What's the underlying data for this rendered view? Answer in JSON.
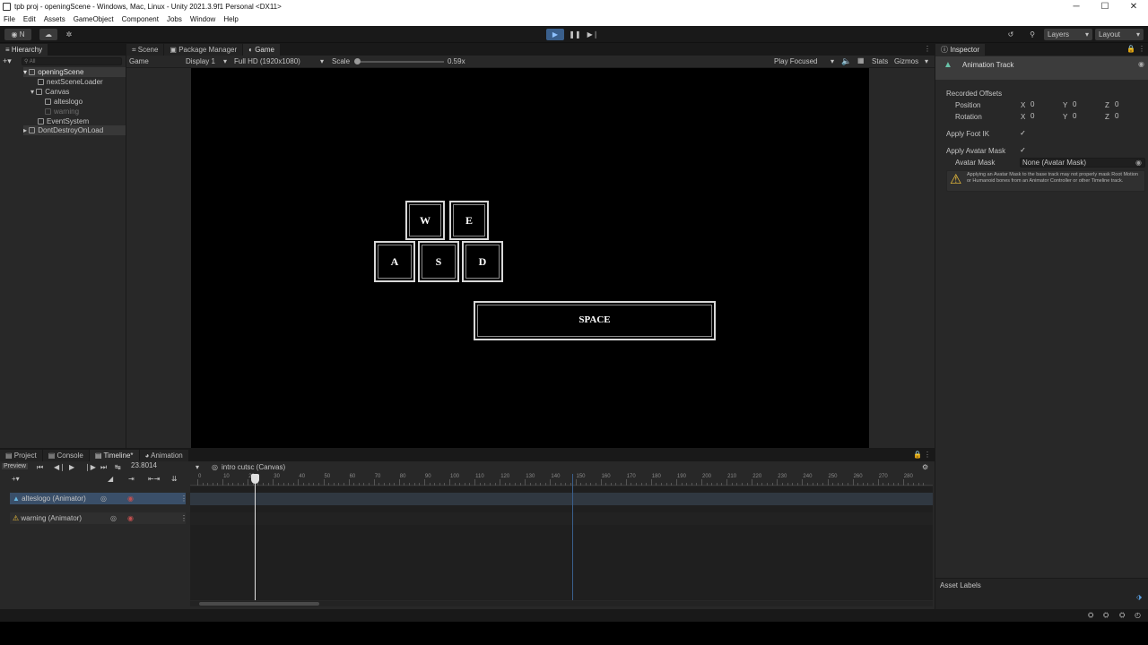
{
  "window": {
    "title": "tpb proj - openingScene - Windows, Mac, Linux - Unity 2021.3.9f1 Personal <DX11>",
    "controls": [
      "─",
      "☐",
      "✕"
    ]
  },
  "menu": [
    "File",
    "Edit",
    "Assets",
    "GameObject",
    "Component",
    "Jobs",
    "Window",
    "Help"
  ],
  "toolbar": {
    "account_label": "N",
    "layers_label": "Layers",
    "layout_label": "Layout"
  },
  "hierarchy": {
    "tab": "Hierarchy",
    "search_placeholder": "All",
    "items": [
      {
        "label": "openingScene"
      },
      {
        "label": "nextSceneLoader"
      },
      {
        "label": "Canvas"
      },
      {
        "label": "alteslogo"
      },
      {
        "label": "warning"
      },
      {
        "label": "EventSystem"
      },
      {
        "label": "DontDestroyOnLoad"
      }
    ]
  },
  "center_tabs": [
    "Scene",
    "Package Manager",
    "Game"
  ],
  "game_toolbar": {
    "view": "Game",
    "display": "Display 1",
    "resolution": "Full HD (1920x1080)",
    "scale_label": "Scale",
    "scale_value": "0.59x",
    "play_mode": "Play Focused",
    "stats": "Stats",
    "gizmos": "Gizmos"
  },
  "game": {
    "keys": [
      "W",
      "E",
      "A",
      "S",
      "D"
    ],
    "space_label": "SPACE"
  },
  "inspector": {
    "tab": "Inspector",
    "track_name": "Animation Track",
    "recorded_offsets": "Recorded Offsets",
    "position_label": "Position",
    "rotation_label": "Rotation",
    "axes": [
      "X",
      "Y",
      "Z"
    ],
    "position": [
      "0",
      "0",
      "0"
    ],
    "rotation": [
      "0",
      "0",
      "0"
    ],
    "apply_foot_ik": "Apply Foot IK",
    "apply_avatar_mask": "Apply Avatar Mask",
    "avatar_mask_label": "Avatar Mask",
    "avatar_mask_value": "None (Avatar Mask)",
    "warning_text": "Applying an Avatar Mask to the base track may not properly mask Root Motion or Humanoid bones from an Animator Controller or other Timeline track.",
    "asset_labels": "Asset Labels"
  },
  "bottom_tabs": [
    "Project",
    "Console",
    "Timeline*",
    "Animation"
  ],
  "timeline": {
    "preview_label": "Preview",
    "time_value": "23.8014",
    "asset_name": "intro cutsc (Canvas)",
    "ruler": [
      "0",
      "10",
      "20",
      "30",
      "40",
      "50",
      "60",
      "70",
      "80",
      "90",
      "100",
      "110",
      "120",
      "130",
      "140",
      "150",
      "160",
      "170",
      "180",
      "190",
      "200",
      "210",
      "220",
      "230",
      "240",
      "250",
      "260",
      "270",
      "280"
    ],
    "tracks": [
      {
        "label": "alteslogo (Animator)"
      },
      {
        "label": "warning (Animator)"
      }
    ]
  },
  "colors": {
    "accent": "#4a90d9",
    "panel": "#282828",
    "toolbar": "#191919",
    "warning": "#f2c33b"
  }
}
